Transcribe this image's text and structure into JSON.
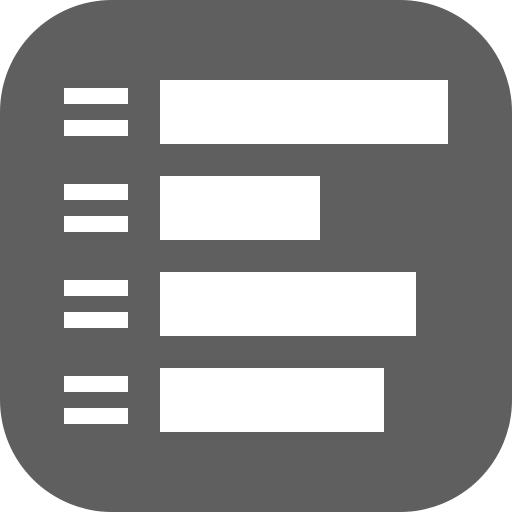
{
  "icon": {
    "name": "horizontal-bar-list-icon",
    "background_color": "#5f5f5f",
    "foreground_color": "#ffffff"
  },
  "rows": [
    {
      "bar_fraction": 1.0
    },
    {
      "bar_fraction": 0.5556
    },
    {
      "bar_fraction": 0.8889
    },
    {
      "bar_fraction": 0.7778
    }
  ]
}
